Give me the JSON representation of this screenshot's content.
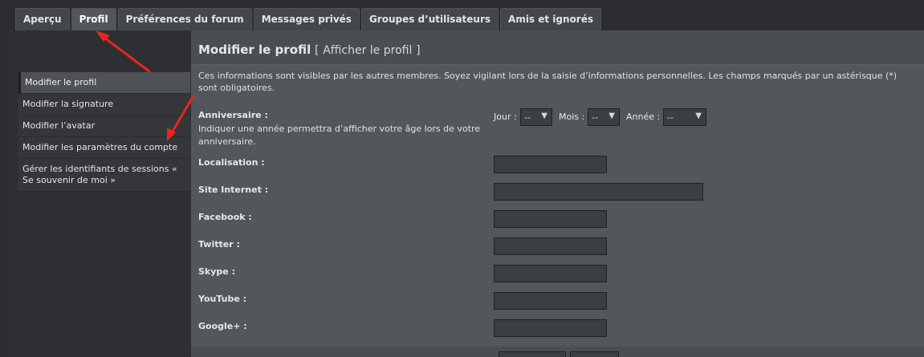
{
  "tabs": [
    {
      "label": "Aperçu"
    },
    {
      "label": "Profil"
    },
    {
      "label": "Préférences du forum"
    },
    {
      "label": "Messages privés"
    },
    {
      "label": "Groupes d’utilisateurs"
    },
    {
      "label": "Amis et ignorés"
    }
  ],
  "menu": [
    {
      "label": "Modifier le profil"
    },
    {
      "label": "Modifier la signature"
    },
    {
      "label": "Modifier l’avatar"
    },
    {
      "label": "Modifier les paramètres du compte"
    },
    {
      "label": "Gérer les identifiants de sessions « Se souvenir de moi »"
    }
  ],
  "heading": {
    "title": "Modifier le profil",
    "link_open": "[",
    "link": "Afficher le profil",
    "link_close": "]"
  },
  "intro": "Ces informations sont visibles par les autres membres. Soyez vigilant lors de la saisie d’informations personnelles. Les champs marqués par un astérisque (*) sont obligatoires.",
  "birthday": {
    "label": "Anniversaire :",
    "hint": "Indiquer une année permettra d’afficher votre âge lors de votre anniversaire.",
    "day_label": "Jour :",
    "day_value": "--",
    "month_label": "Mois :",
    "month_value": "--",
    "year_label": "Année :",
    "year_value": "--"
  },
  "fields": {
    "location": {
      "label": "Localisation :",
      "value": ""
    },
    "website": {
      "label": "Site Internet :",
      "value": ""
    },
    "facebook": {
      "label": "Facebook :",
      "value": ""
    },
    "twitter": {
      "label": "Twitter :",
      "value": ""
    },
    "skype": {
      "label": "Skype :",
      "value": ""
    },
    "youtube": {
      "label": "YouTube :",
      "value": ""
    },
    "googleplus": {
      "label": "Google+ :",
      "value": ""
    }
  },
  "colors": {
    "annotation_arrow": "#e8261f",
    "panel": "#4a4d52",
    "content": "#53565b"
  },
  "icons": {
    "dropdown": "caret-down-icon",
    "annotation": "red-arrow-icon"
  }
}
